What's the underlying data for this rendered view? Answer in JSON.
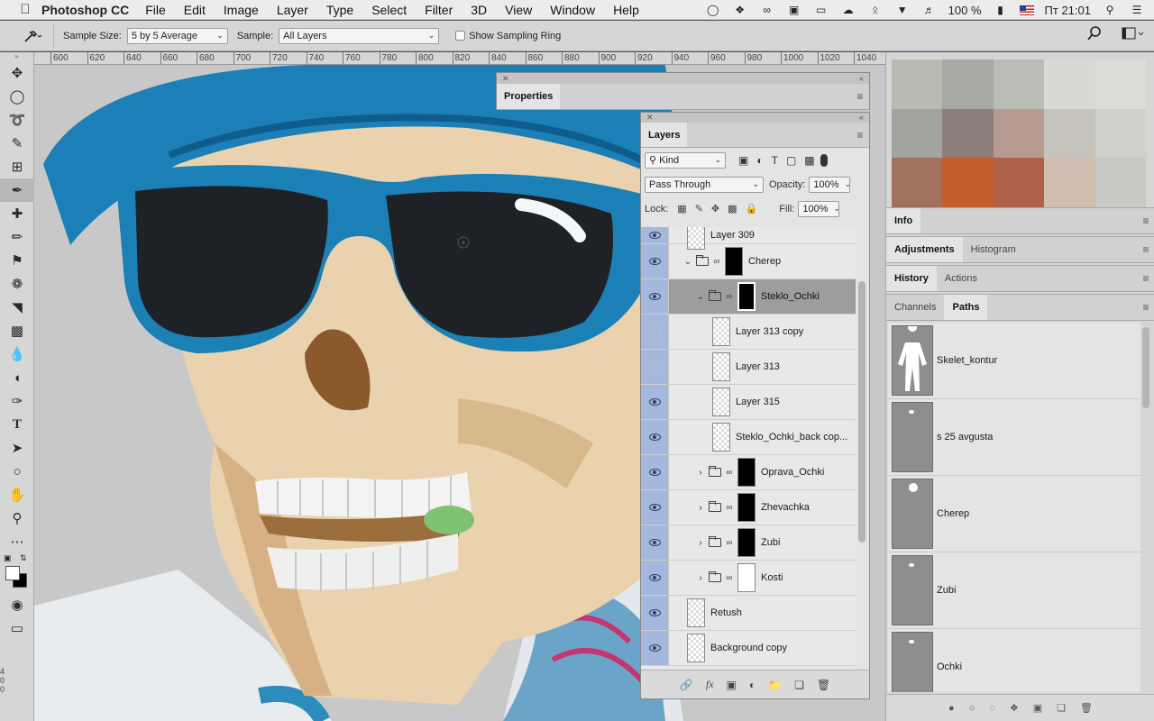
{
  "menubar": {
    "app": "Photoshop CC",
    "items": [
      "File",
      "Edit",
      "Image",
      "Layer",
      "Type",
      "Select",
      "Filter",
      "3D",
      "View",
      "Window",
      "Help"
    ],
    "battery": "100 %",
    "clock": "Пт 21:01"
  },
  "options": {
    "sample_size_label": "Sample Size:",
    "sample_size_value": "5 by 5 Average",
    "sample_label": "Sample:",
    "sample_value": "All Layers",
    "sampling_ring_label": "Show Sampling Ring"
  },
  "ruler": {
    "ticks": [
      "600",
      "620",
      "640",
      "660",
      "680",
      "700",
      "720",
      "740",
      "760",
      "780",
      "800",
      "820",
      "840",
      "860",
      "880",
      "900",
      "920",
      "940",
      "960",
      "980",
      "1000",
      "1020",
      "1040"
    ],
    "vertical": [
      "4",
      "0",
      "0"
    ]
  },
  "properties": {
    "title": "Properties"
  },
  "layers": {
    "title": "Layers",
    "kind_filter": "Kind",
    "blend_mode": "Pass Through",
    "opacity_label": "Opacity:",
    "opacity_value": "100%",
    "lock_label": "Lock:",
    "fill_label": "Fill:",
    "fill_value": "100%",
    "items": [
      {
        "name": "Layer 309",
        "visible": true,
        "indent": 1
      },
      {
        "name": "Cherep",
        "visible": true,
        "group": true,
        "open": true,
        "indent": 1,
        "mask": "black"
      },
      {
        "name": "Steklo_Ochki",
        "visible": true,
        "group": true,
        "open": true,
        "indent": 2,
        "mask": "black",
        "selected": true
      },
      {
        "name": "Layer 313 copy",
        "visible": false,
        "indent": 3
      },
      {
        "name": "Layer 313",
        "visible": false,
        "indent": 3
      },
      {
        "name": "Layer 315",
        "visible": true,
        "indent": 3
      },
      {
        "name": "Steklo_Ochki_back cop...",
        "visible": true,
        "indent": 3
      },
      {
        "name": "Oprava_Ochki",
        "visible": true,
        "group": true,
        "open": false,
        "indent": 2,
        "mask": "black"
      },
      {
        "name": "Zhevachka",
        "visible": true,
        "group": true,
        "open": false,
        "indent": 2,
        "mask": "black"
      },
      {
        "name": "Zubi",
        "visible": true,
        "group": true,
        "open": false,
        "indent": 2,
        "mask": "black"
      },
      {
        "name": "Kosti",
        "visible": true,
        "group": true,
        "open": false,
        "indent": 2,
        "mask": "white"
      },
      {
        "name": "Retush",
        "visible": true,
        "indent": 1
      },
      {
        "name": "Background copy",
        "visible": true,
        "indent": 1
      }
    ]
  },
  "dock": {
    "swatches": [
      "#b8bbb2",
      "#a7aaa4",
      "#babcb6",
      "#d9d9d3",
      "#dcdcd8",
      "#a2a49f",
      "#8c7f79",
      "#b79b91",
      "#c6c3bd",
      "#cfcfcb",
      "#a0725d",
      "#c45c2c",
      "#ad6249",
      "#d0bdb0",
      "#c8c8c4"
    ],
    "info_tab": "Info",
    "adjustments_tab": "Adjustments",
    "histogram_tab": "Histogram",
    "history_tab": "History",
    "actions_tab": "Actions",
    "channels_tab": "Channels",
    "paths_tab": "Paths",
    "paths": [
      {
        "name": "Skelet_kontur"
      },
      {
        "name": "s 25 avgusta"
      },
      {
        "name": "Cherep"
      },
      {
        "name": "Zubi"
      },
      {
        "name": "Ochki"
      }
    ]
  }
}
